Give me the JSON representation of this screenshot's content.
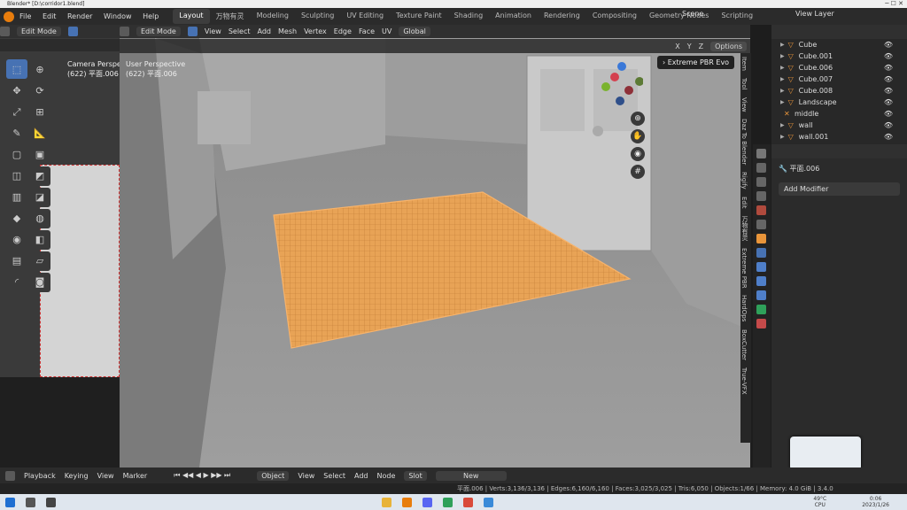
{
  "titlebar": {
    "title": "Blender* [D:\\corridor1.blend]"
  },
  "topbar": {
    "menu": [
      "File",
      "Edit",
      "Render",
      "Window",
      "Help"
    ],
    "workspaces": [
      "Layout",
      "万物有灵",
      "Modeling",
      "Sculpting",
      "UV Editing",
      "Texture Paint",
      "Shading",
      "Animation",
      "Rendering",
      "Compositing",
      "Geometry Nodes",
      "Scripting"
    ],
    "active_workspace": "Layout",
    "scene": "Scene",
    "view_layer": "View Layer"
  },
  "left_viewport": {
    "mode": "Edit Mode",
    "view_name": "Camera Perspective",
    "object_line": "(622) 平面.006"
  },
  "main_viewport": {
    "mode": "Edit Mode",
    "menus": [
      "View",
      "Select",
      "Add",
      "Mesh",
      "Vertex",
      "Edge",
      "Face",
      "UV"
    ],
    "transform_orientation": "Global",
    "view_name": "User Perspective",
    "object_line": "(622) 平面.006",
    "axes": [
      "X",
      "Y",
      "Z"
    ],
    "options_label": "Options",
    "addon_panel": "Extreme PBR Evo"
  },
  "sidebar_tabs": [
    "Item",
    "Tool",
    "View",
    "Daz To Blender",
    "Rigify",
    "Edit",
    "万物有灵",
    "Extreme PBR",
    "HardOps",
    "BoxCutter",
    "True-VFX"
  ],
  "outliner": {
    "items": [
      {
        "name": "Cube",
        "type": "mesh"
      },
      {
        "name": "Cube.001",
        "type": "mesh"
      },
      {
        "name": "Cube.006",
        "type": "mesh"
      },
      {
        "name": "Cube.007",
        "type": "mesh"
      },
      {
        "name": "Cube.008",
        "type": "mesh"
      },
      {
        "name": "Landscape",
        "type": "mesh"
      },
      {
        "name": "middle",
        "type": "empty"
      },
      {
        "name": "wall",
        "type": "mesh"
      },
      {
        "name": "wall.001",
        "type": "mesh"
      }
    ]
  },
  "properties": {
    "object_name": "平面.006",
    "add_modifier": "Add Modifier"
  },
  "bottom_timeline": {
    "menus": [
      "Playback",
      "Keying",
      "View",
      "Marker"
    ],
    "node_object": "Object",
    "node_menus": [
      "View",
      "Select",
      "Add",
      "Node"
    ],
    "slot": "Slot",
    "new_label": "New"
  },
  "statusbar": {
    "text": "平面.006 | Verts:3,136/3,136 | Edges:6,160/6,160 | Faces:3,025/3,025 | Tris:6,050 | Objects:1/66 | Memory: 4.0 GiB | 3.4.0"
  },
  "taskbar": {
    "temp": "49°C",
    "cpu": "CPU",
    "time": "0:06",
    "date": "2023/1/26"
  },
  "colors": {
    "accent": "#4772b3",
    "selection_orange": "#e9953a",
    "viewport_gray": "#8e8e8e"
  }
}
